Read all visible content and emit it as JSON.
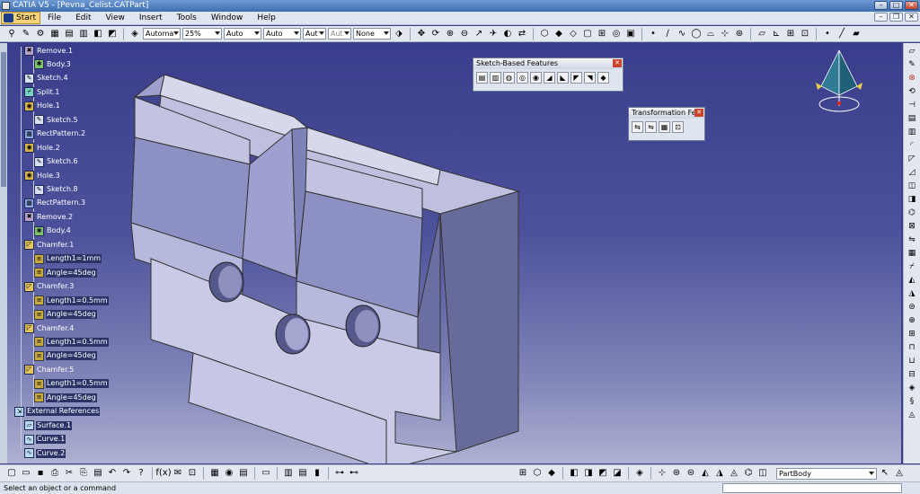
{
  "window": {
    "title": "CATIA V5 - [Pevna_Celist.CATPart]"
  },
  "menu": {
    "start": "Start",
    "items": [
      "File",
      "Edit",
      "View",
      "Insert",
      "Tools",
      "Window",
      "Help"
    ]
  },
  "toolbar": {
    "combos": [
      "Automa",
      "25%",
      "Auto",
      "Auto",
      "Aut",
      "Aut",
      "None"
    ]
  },
  "tree": {
    "nodes": [
      {
        "label": "Remove.1",
        "icon": "remove-icon"
      },
      {
        "label": "Body.3",
        "icon": "body-icon"
      },
      {
        "label": "Sketch.4",
        "icon": "sketch-icon"
      },
      {
        "label": "Split.1",
        "icon": "split-icon"
      },
      {
        "label": "Hole.1",
        "icon": "hole-icon"
      },
      {
        "label": "Sketch.5",
        "icon": "sketch-icon"
      },
      {
        "label": "RectPattern.2",
        "icon": "pattern-icon"
      },
      {
        "label": "Hole.2",
        "icon": "hole-icon"
      },
      {
        "label": "Sketch.6",
        "icon": "sketch-icon"
      },
      {
        "label": "Hole.3",
        "icon": "hole-icon"
      },
      {
        "label": "Sketch.8",
        "icon": "sketch-icon"
      },
      {
        "label": "RectPattern.3",
        "icon": "pattern-icon"
      },
      {
        "label": "Remove.2",
        "icon": "remove-icon"
      },
      {
        "label": "Body.4",
        "icon": "body-icon"
      },
      {
        "label": "Chamfer.1",
        "icon": "chamfer-icon"
      },
      {
        "label": "Length1=1mm",
        "icon": "parameter-icon"
      },
      {
        "label": "Angle=45deg",
        "icon": "parameter-icon"
      },
      {
        "label": "Chamfer.3",
        "icon": "chamfer-icon"
      },
      {
        "label": "Length1=0.5mm",
        "icon": "parameter-icon"
      },
      {
        "label": "Angle=45deg",
        "icon": "parameter-icon"
      },
      {
        "label": "Chamfer.4",
        "icon": "chamfer-icon"
      },
      {
        "label": "Length1=0.5mm",
        "icon": "parameter-icon"
      },
      {
        "label": "Angle=45deg",
        "icon": "parameter-icon"
      },
      {
        "label": "Chamfer.5",
        "icon": "chamfer-icon"
      },
      {
        "label": "Length1=0.5mm",
        "icon": "parameter-icon"
      },
      {
        "label": "Angle=45deg",
        "icon": "parameter-icon"
      },
      {
        "label": "External References",
        "icon": "external-references-icon"
      },
      {
        "label": "Surface.1",
        "icon": "surface-icon"
      },
      {
        "label": "Curve.1",
        "icon": "curve-icon"
      },
      {
        "label": "Curve.2",
        "icon": "curve-icon"
      }
    ]
  },
  "floating": {
    "sketch_based": {
      "title": "Sketch-Based Features"
    },
    "transformation": {
      "title": "Transformation Fe..."
    }
  },
  "bottom": {
    "part_body": "PartBody"
  },
  "status": {
    "message": "Select an object or a command"
  }
}
